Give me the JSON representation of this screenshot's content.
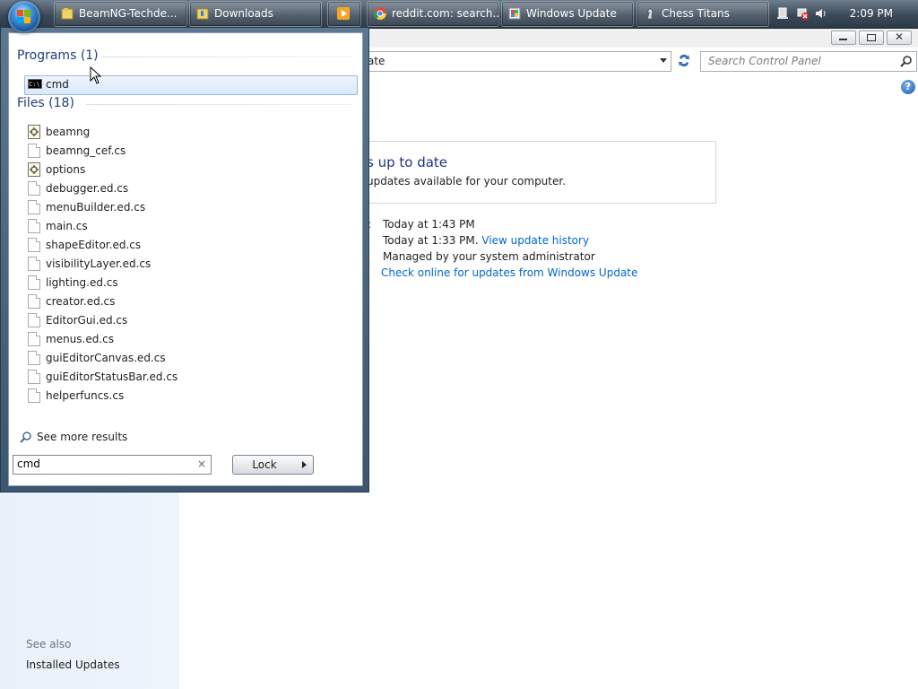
{
  "taskbar": {
    "buttons": [
      {
        "label": "BeamNG-Techde...",
        "icon": "folder-icon"
      },
      {
        "label": "Downloads",
        "icon": "folder-icon"
      },
      {
        "label": "",
        "icon": "media-player-icon"
      },
      {
        "label": "reddit.com: search...",
        "icon": "chrome-icon"
      },
      {
        "label": "Windows Update",
        "icon": "windows-update-icon"
      },
      {
        "label": "Chess Titans",
        "icon": "chess-icon"
      }
    ],
    "clock": "2:09 PM"
  },
  "window": {
    "address_fragment": "ate",
    "search_placeholder": "Search Control Panel",
    "help": "?",
    "status_title": "s up to date",
    "status_sub": "updates available for your computer.",
    "colon": ":",
    "info": [
      {
        "text": "Today at 1:43 PM",
        "link": ""
      },
      {
        "text": "Today at 1:33 PM.",
        "link": "View update history"
      },
      {
        "text": "Managed by your system administrator",
        "link": ""
      },
      {
        "text": "",
        "link": "Check online for updates from Windows Update"
      }
    ],
    "see_also": "See also",
    "installed_updates": "Installed Updates"
  },
  "start_menu": {
    "programs_header": "Programs (1)",
    "programs": [
      {
        "label": "cmd",
        "icon": "cmd-icon"
      }
    ],
    "files_header": "Files (18)",
    "files": [
      {
        "label": "beamng",
        "icon": "config-file-icon"
      },
      {
        "label": "beamng_cef.cs",
        "icon": "file-icon"
      },
      {
        "label": "options",
        "icon": "config-file-icon"
      },
      {
        "label": "debugger.ed.cs",
        "icon": "file-icon"
      },
      {
        "label": "menuBuilder.ed.cs",
        "icon": "file-icon"
      },
      {
        "label": "main.cs",
        "icon": "file-icon"
      },
      {
        "label": "shapeEditor.ed.cs",
        "icon": "file-icon"
      },
      {
        "label": "visibilityLayer.ed.cs",
        "icon": "file-icon"
      },
      {
        "label": "lighting.ed.cs",
        "icon": "file-icon"
      },
      {
        "label": "creator.ed.cs",
        "icon": "file-icon"
      },
      {
        "label": "EditorGui.ed.cs",
        "icon": "file-icon"
      },
      {
        "label": "menus.ed.cs",
        "icon": "file-icon"
      },
      {
        "label": "guiEditorCanvas.ed.cs",
        "icon": "file-icon"
      },
      {
        "label": "guiEditorStatusBar.ed.cs",
        "icon": "file-icon"
      },
      {
        "label": "helperfuncs.cs",
        "icon": "file-icon"
      }
    ],
    "see_more": "See more results",
    "search_value": "cmd",
    "clear": "×",
    "lock_label": "Lock"
  }
}
